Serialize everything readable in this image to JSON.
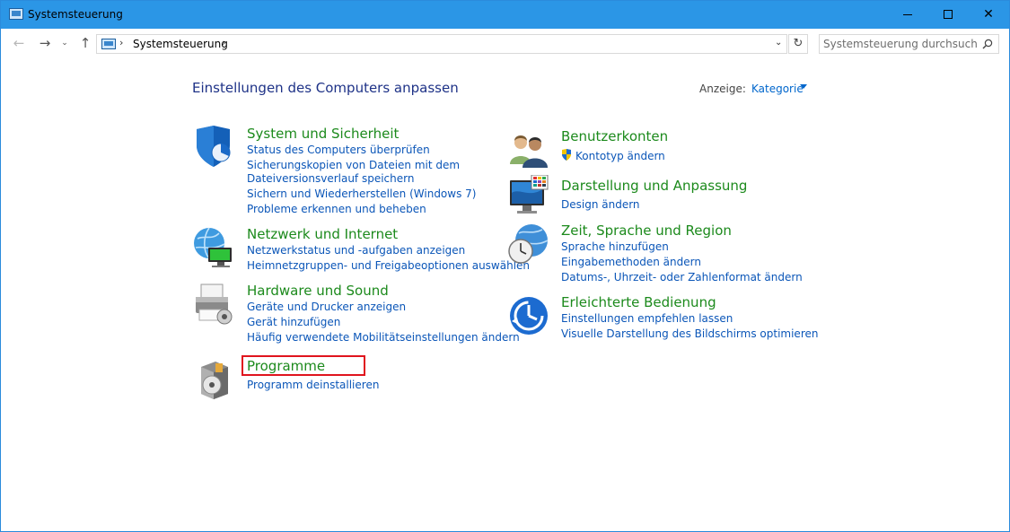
{
  "window": {
    "title": "Systemsteuerung"
  },
  "address": {
    "path": "Systemsteuerung",
    "search_placeholder": "Systemsteuerung durchsuchen"
  },
  "main": {
    "heading": "Einstellungen des Computers anpassen",
    "view_label": "Anzeige:",
    "view_value": "Kategorie"
  },
  "categories": {
    "system": {
      "title": "System und Sicherheit",
      "links": [
        "Status des Computers überprüfen",
        "Sicherungskopien von Dateien mit dem",
        "Dateiversionsverlauf speichern",
        "Sichern und Wiederherstellen (Windows 7)",
        "Probleme erkennen und beheben"
      ]
    },
    "network": {
      "title": "Netzwerk und Internet",
      "links": [
        "Netzwerkstatus und -aufgaben anzeigen",
        "Heimnetzgruppen- und Freigabeoptionen auswählen"
      ]
    },
    "hardware": {
      "title": "Hardware und Sound",
      "links": [
        "Geräte und Drucker anzeigen",
        "Gerät hinzufügen",
        "Häufig verwendete Mobilitätseinstellungen ändern"
      ]
    },
    "programs": {
      "title": "Programme",
      "links": [
        "Programm deinstallieren"
      ]
    },
    "users": {
      "title": "Benutzerkonten",
      "links": [
        "Kontotyp ändern"
      ]
    },
    "appearance": {
      "title": "Darstellung und Anpassung",
      "links": [
        "Design ändern"
      ]
    },
    "clock": {
      "title": "Zeit, Sprache und Region",
      "links": [
        "Sprache hinzufügen",
        "Eingabemethoden ändern",
        "Datums-, Uhrzeit- oder Zahlenformat ändern"
      ]
    },
    "ease": {
      "title": "Erleichterte Bedienung",
      "links": [
        "Einstellungen empfehlen lassen",
        "Visuelle Darstellung des Bildschirms optimieren"
      ]
    }
  },
  "colors": {
    "titlebar": "#2b96e6",
    "heading": "#1e3287",
    "category_title": "#1c8a1c",
    "link": "#0b56b8",
    "highlight": "#e0141e"
  }
}
